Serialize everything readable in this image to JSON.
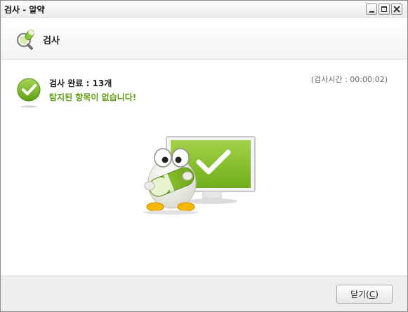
{
  "window": {
    "title": "검사 - 알약"
  },
  "header": {
    "title": "검사",
    "icon": "alyac-scan-icon"
  },
  "result": {
    "summary": "검사 완료 : 13개",
    "message": "탐지된 항목이 없습니다!",
    "elapsed": "(검사시간 : 00:00:02)",
    "icon": "check-circle-icon"
  },
  "illustration": {
    "icon": "alyac-mascot-monitor-check"
  },
  "footer": {
    "close_label_prefix": "닫기(",
    "close_label_key": "C",
    "close_label_suffix": ")"
  },
  "colors": {
    "accent_green": "#8cc63f",
    "message_green": "#5f9e12"
  }
}
